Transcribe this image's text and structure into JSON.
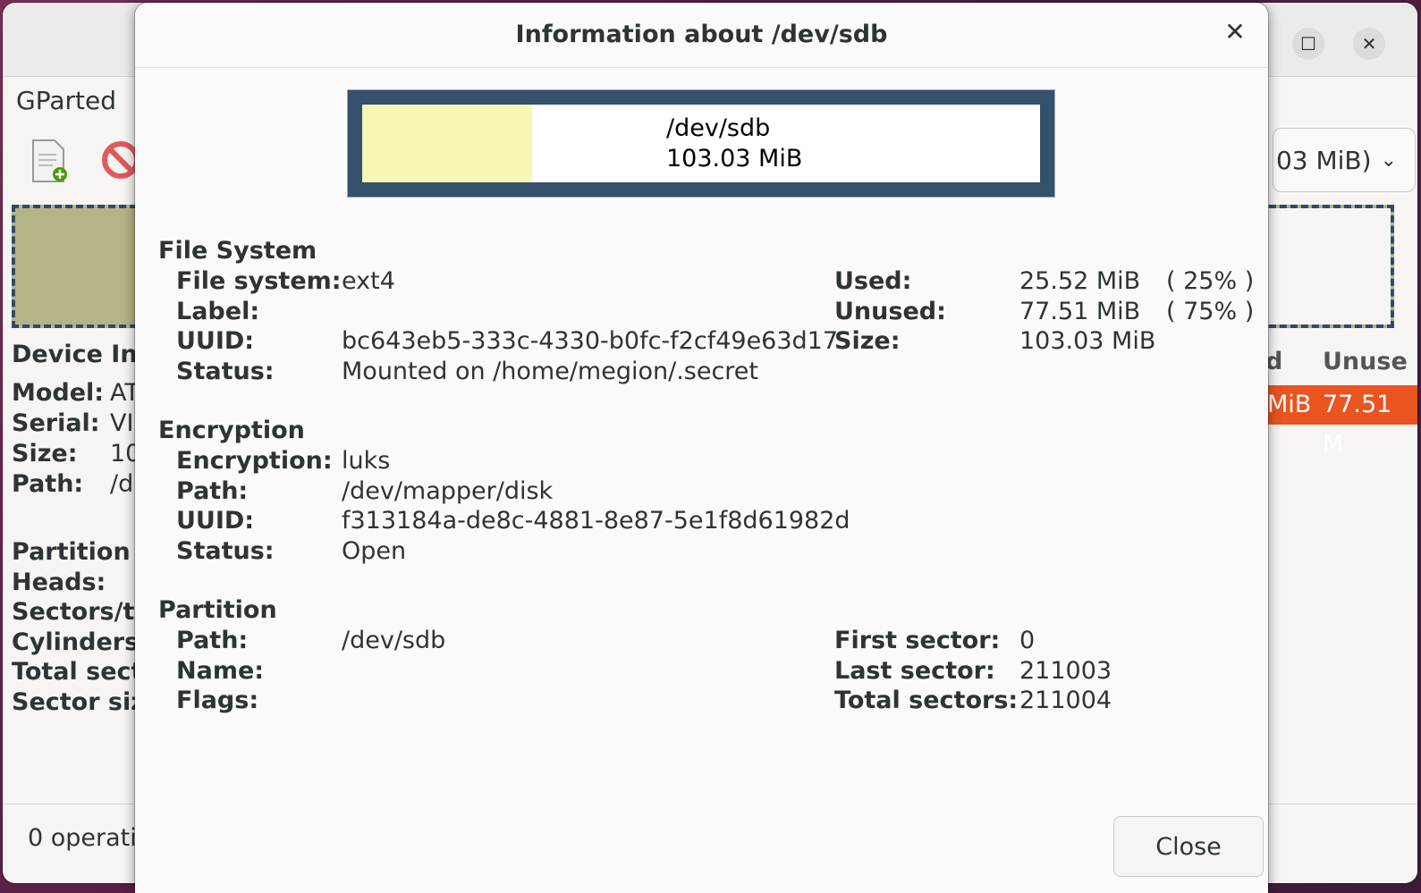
{
  "app": {
    "menu_label": "GParted",
    "device_combo_text": "03 MiB)",
    "device_info_title": "Device Inf",
    "device_info_rows": [
      {
        "label": "Model:",
        "value": "AT"
      },
      {
        "label": "Serial:",
        "value": "VI"
      },
      {
        "label": "Size:",
        "value": "10"
      },
      {
        "label": "Path:",
        "value": "/d"
      }
    ],
    "device_info_rows2": [
      "Partition t",
      "Heads:",
      "Sectors/tr",
      "Cylinders:",
      "Total secto",
      "Sector size"
    ],
    "partition_list_header": [
      "d",
      "Unuse"
    ],
    "partition_list_row": [
      "MiB",
      "77.51 M"
    ],
    "status_text": "0 operati"
  },
  "dialog": {
    "title": "Information about /dev/sdb",
    "disk_graphic": {
      "path": "/dev/sdb",
      "size": "103.03 MiB",
      "used_fraction": 0.25
    },
    "file_system": {
      "section_title": "File System",
      "rows": [
        {
          "label": "File system:",
          "value": "ext4"
        },
        {
          "label": "Label:",
          "value": ""
        },
        {
          "label": "UUID:",
          "value": "bc643eb5-333c-4330-b0fc-f2cf49e63d17"
        },
        {
          "label": "Status:",
          "value": "Mounted on /home/megion/.secret"
        }
      ],
      "usage": [
        {
          "label": "Used:",
          "value": "25.52 MiB",
          "percent": "( 25% )"
        },
        {
          "label": "Unused:",
          "value": "77.51 MiB",
          "percent": "( 75% )"
        },
        {
          "label": "Size:",
          "value": "103.03 MiB",
          "percent": ""
        }
      ]
    },
    "encryption": {
      "section_title": "Encryption",
      "rows": [
        {
          "label": "Encryption:",
          "value": "luks"
        },
        {
          "label": "Path:",
          "value": "/dev/mapper/disk"
        },
        {
          "label": "UUID:",
          "value": "f313184a-de8c-4881-8e87-5e1f8d61982d"
        },
        {
          "label": "Status:",
          "value": "Open"
        }
      ]
    },
    "partition": {
      "section_title": "Partition",
      "rows": [
        {
          "label": "Path:",
          "value": "/dev/sdb"
        },
        {
          "label": "Name:",
          "value": ""
        },
        {
          "label": "Flags:",
          "value": ""
        }
      ],
      "sectors": [
        {
          "label": "First sector:",
          "value": "0"
        },
        {
          "label": "Last sector:",
          "value": "211003"
        },
        {
          "label": "Total sectors:",
          "value": "211004"
        }
      ]
    },
    "close_label": "Close"
  },
  "colors": {
    "disk_border": "#34506b",
    "used_fill": "#f6f6b5",
    "partition_highlight": "#e95420"
  }
}
